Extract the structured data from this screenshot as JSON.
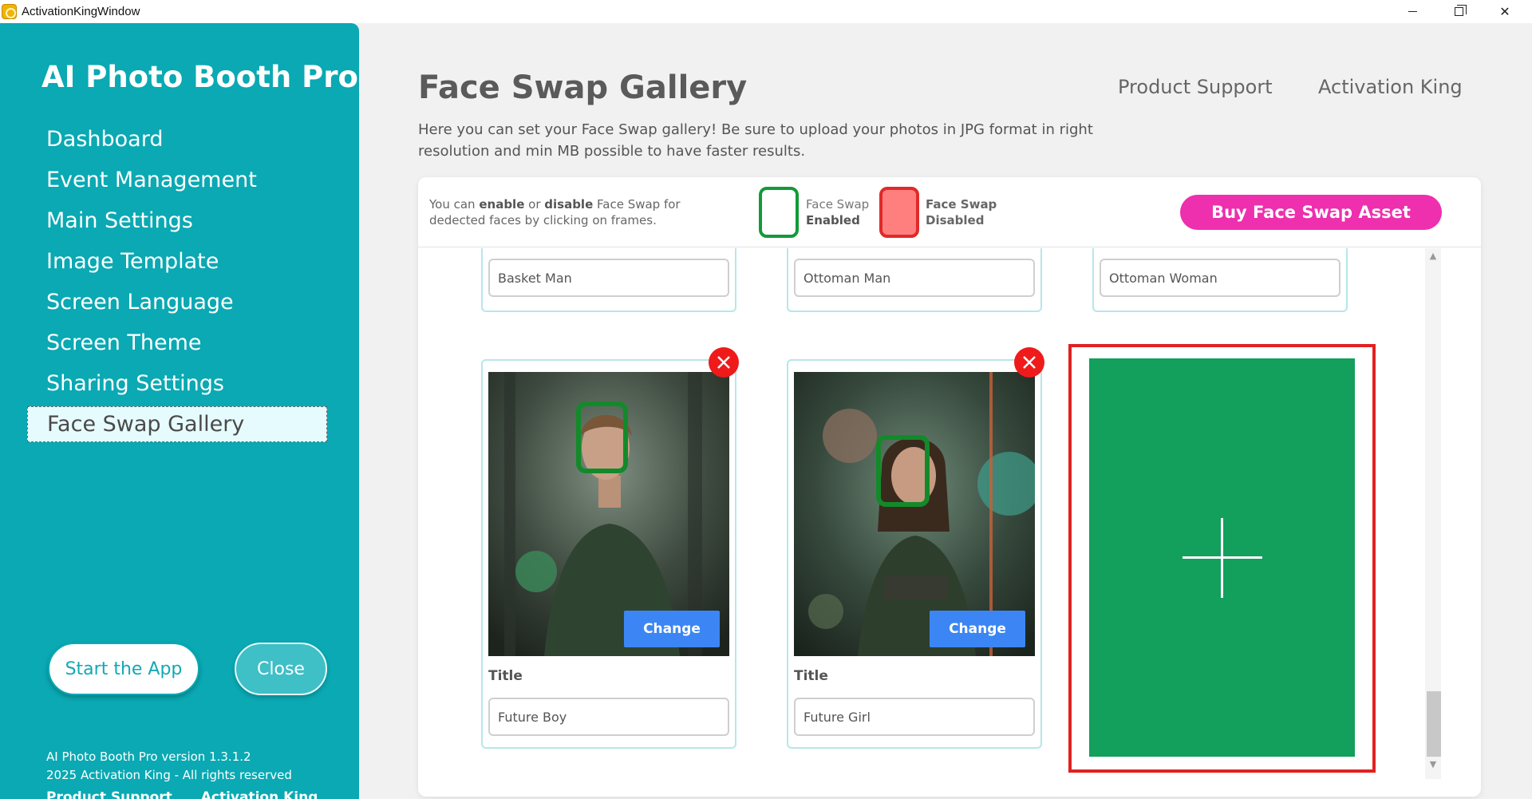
{
  "window": {
    "title": "ActivationKingWindow"
  },
  "sidebar": {
    "brand": "AI Photo Booth Pro",
    "items": [
      {
        "label": "Dashboard"
      },
      {
        "label": "Event Management"
      },
      {
        "label": "Main Settings"
      },
      {
        "label": "Image Template"
      },
      {
        "label": "Screen Language"
      },
      {
        "label": "Screen Theme"
      },
      {
        "label": "Sharing Settings"
      },
      {
        "label": "Face Swap Gallery",
        "active": true
      }
    ],
    "start_label": "Start the App",
    "close_label": "Close",
    "version": "AI Photo Booth Pro version 1.3.1.2",
    "copyright": "2025 Activation King - All rights reserved",
    "footer_links": [
      "Product Support",
      "Activation King"
    ]
  },
  "header": {
    "title": "Face Swap Gallery",
    "links": [
      "Product Support",
      "Activation King"
    ],
    "description": "Here you can set your Face Swap gallery! Be sure to upload your photos in JPG format in right resolution and min MB possible to have faster results."
  },
  "legend": {
    "hint_prefix": "You can ",
    "hint_enable": "enable",
    "hint_or": " or ",
    "hint_disable": "disable",
    "hint_suffix": " Face Swap for dedected faces by clicking on frames.",
    "enabled_line1": "Face Swap",
    "enabled_line2": "Enabled",
    "disabled_line1": "Face Swap",
    "disabled_line2": "Disabled",
    "buy_label": "Buy Face Swap Asset",
    "enabled_color": "#139a38",
    "disabled_color": "#e02a2a"
  },
  "gallery": {
    "top_row": [
      {
        "title_value": "Basket Man"
      },
      {
        "title_value": "Ottoman Man"
      },
      {
        "title_value": "Ottoman Woman"
      }
    ],
    "cards": [
      {
        "title_label": "Title",
        "title_value": "Future Boy",
        "change_label": "Change",
        "face_swap": "enabled"
      },
      {
        "title_label": "Title",
        "title_value": "Future Girl",
        "change_label": "Change",
        "face_swap": "enabled"
      }
    ]
  },
  "colors": {
    "sidebar": "#0aa9b3",
    "buy_button": "#ee2fae",
    "add_tile": "#12a05c",
    "add_border": "#e12121",
    "change_button": "#3b86f4"
  }
}
